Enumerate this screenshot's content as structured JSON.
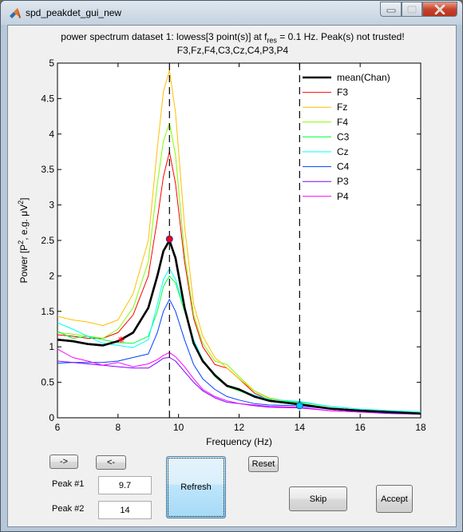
{
  "window": {
    "title": "spd_peakdet_gui_new",
    "controls": {
      "minimize": "minimize",
      "maximize": "maximize",
      "close": "close"
    }
  },
  "plot": {
    "title_prefix": "power spectrum dataset 1: lowess[3 point(s)] at f",
    "title_sub": "res",
    "title_suffix": " = 0.1 Hz. Peak(s) not trusted!",
    "subtitle": "F3,Fz,F4,C3,Cz,C4,P3,P4"
  },
  "chart_data": {
    "type": "line",
    "title": "power spectrum dataset 1: lowess[3 point(s)] at f_res = 0.1 Hz. Peak(s) not trusted!",
    "subtitle": "F3,Fz,F4,C3,Cz,C4,P3,P4",
    "xlabel": "Frequency (Hz)",
    "ylabel_main": "Power [P",
    "ylabel_sup": "2",
    "ylabel_mid": ", e.g. μV",
    "ylabel_sup2": "2",
    "ylabel_end": "]",
    "xlim": [
      6,
      18
    ],
    "ylim": [
      0,
      5
    ],
    "xticks": [
      6,
      8,
      10,
      12,
      14,
      16,
      18
    ],
    "yticks": [
      0,
      0.5,
      1,
      1.5,
      2,
      2.5,
      3,
      3.5,
      4,
      4.5,
      5
    ],
    "ytick_labels": [
      "0",
      "0.5",
      "1",
      "1.5",
      "2",
      "2.5",
      "3",
      "3.5",
      "4",
      "4.5",
      "5"
    ],
    "grid": false,
    "legend_position": "top-right",
    "x": [
      6.0,
      6.5,
      7.0,
      7.5,
      8.0,
      8.5,
      9.0,
      9.3,
      9.5,
      9.7,
      9.9,
      10.2,
      10.5,
      10.8,
      11.2,
      11.6,
      12.0,
      12.5,
      13.0,
      14.0,
      15.0,
      16.0,
      17.0,
      18.0
    ],
    "series": [
      {
        "name": "mean(Chan)",
        "color": "#000000",
        "width": "thick",
        "values": [
          1.1,
          1.08,
          1.04,
          1.02,
          1.08,
          1.2,
          1.55,
          2.0,
          2.35,
          2.5,
          2.25,
          1.55,
          1.05,
          0.8,
          0.6,
          0.45,
          0.4,
          0.3,
          0.24,
          0.19,
          0.13,
          0.1,
          0.08,
          0.06
        ]
      },
      {
        "name": "F3",
        "color": "#ff0000",
        "values": [
          1.17,
          1.15,
          1.12,
          1.12,
          1.2,
          1.45,
          2.0,
          2.8,
          3.4,
          3.75,
          3.3,
          2.2,
          1.4,
          1.0,
          0.75,
          0.7,
          0.55,
          0.35,
          0.25,
          0.18,
          0.12,
          0.09,
          0.07,
          0.06
        ]
      },
      {
        "name": "Fz",
        "color": "#ffbf00",
        "values": [
          1.43,
          1.38,
          1.35,
          1.3,
          1.38,
          1.75,
          2.5,
          3.8,
          4.6,
          4.9,
          4.3,
          2.7,
          1.6,
          1.15,
          0.85,
          0.7,
          0.55,
          0.38,
          0.28,
          0.2,
          0.14,
          0.1,
          0.08,
          0.06
        ]
      },
      {
        "name": "F4",
        "color": "#80ff00",
        "values": [
          1.2,
          1.18,
          1.15,
          1.12,
          1.25,
          1.55,
          2.2,
          3.3,
          3.9,
          4.15,
          3.7,
          2.3,
          1.45,
          1.05,
          0.8,
          0.75,
          0.58,
          0.38,
          0.27,
          0.2,
          0.14,
          0.1,
          0.09,
          0.07
        ]
      },
      {
        "name": "C3",
        "color": "#00ff40",
        "values": [
          1.22,
          1.12,
          1.15,
          1.1,
          1.06,
          1.05,
          1.15,
          1.5,
          1.85,
          2.0,
          1.9,
          1.5,
          1.05,
          0.8,
          0.58,
          0.44,
          0.38,
          0.3,
          0.24,
          0.22,
          0.16,
          0.12,
          0.1,
          0.08
        ]
      },
      {
        "name": "Cz",
        "color": "#00ffff",
        "values": [
          1.34,
          1.25,
          1.15,
          1.05,
          1.02,
          0.99,
          1.1,
          1.6,
          1.95,
          2.1,
          1.95,
          1.55,
          1.1,
          0.82,
          0.6,
          0.45,
          0.4,
          0.32,
          0.26,
          0.23,
          0.16,
          0.12,
          0.1,
          0.08
        ]
      },
      {
        "name": "C4",
        "color": "#0040ff",
        "values": [
          0.77,
          0.78,
          0.78,
          0.78,
          0.8,
          0.85,
          0.9,
          1.2,
          1.5,
          1.67,
          1.5,
          1.1,
          0.75,
          0.55,
          0.4,
          0.3,
          0.25,
          0.2,
          0.18,
          0.17,
          0.12,
          0.09,
          0.07,
          0.06
        ]
      },
      {
        "name": "P3",
        "color": "#8000ff",
        "values": [
          0.8,
          0.78,
          0.76,
          0.74,
          0.72,
          0.7,
          0.7,
          0.78,
          0.84,
          0.85,
          0.8,
          0.65,
          0.5,
          0.38,
          0.28,
          0.22,
          0.2,
          0.17,
          0.15,
          0.14,
          0.1,
          0.08,
          0.06,
          0.05
        ]
      },
      {
        "name": "P4",
        "color": "#ff00ff",
        "values": [
          0.97,
          0.85,
          0.8,
          0.74,
          0.78,
          0.72,
          0.76,
          0.82,
          0.88,
          0.92,
          0.86,
          0.72,
          0.55,
          0.4,
          0.3,
          0.24,
          0.2,
          0.18,
          0.16,
          0.15,
          0.1,
          0.08,
          0.07,
          0.05
        ]
      }
    ],
    "vlines": [
      {
        "x": 9.7,
        "style": "dashed",
        "color": "#000000"
      },
      {
        "x": 14.0,
        "style": "dashed",
        "color": "#000000"
      }
    ],
    "markers": [
      {
        "name": "peak-1-marker",
        "x": 9.7,
        "y": 2.52,
        "shape": "circle",
        "fill": "#ff0000",
        "stroke": "#3030c0"
      },
      {
        "name": "peak-2-marker",
        "x": 14.0,
        "y": 0.17,
        "shape": "circle",
        "fill": "#00c8ff",
        "stroke": "#0060a0"
      },
      {
        "name": "trough-marker",
        "x": 8.1,
        "y": 1.1,
        "shape": "asterisk",
        "fill": "#ff0000",
        "stroke": "#ff0000"
      }
    ]
  },
  "controls": {
    "next_label": "->",
    "prev_label": "<-",
    "refresh_label": "Refresh",
    "reset_label": "Reset",
    "skip_label": "Skip",
    "accept_label": "Accept",
    "peak1_label": "Peak #1",
    "peak1_value": "9.7",
    "peak2_label": "Peak #2",
    "peak2_value": "14"
  }
}
